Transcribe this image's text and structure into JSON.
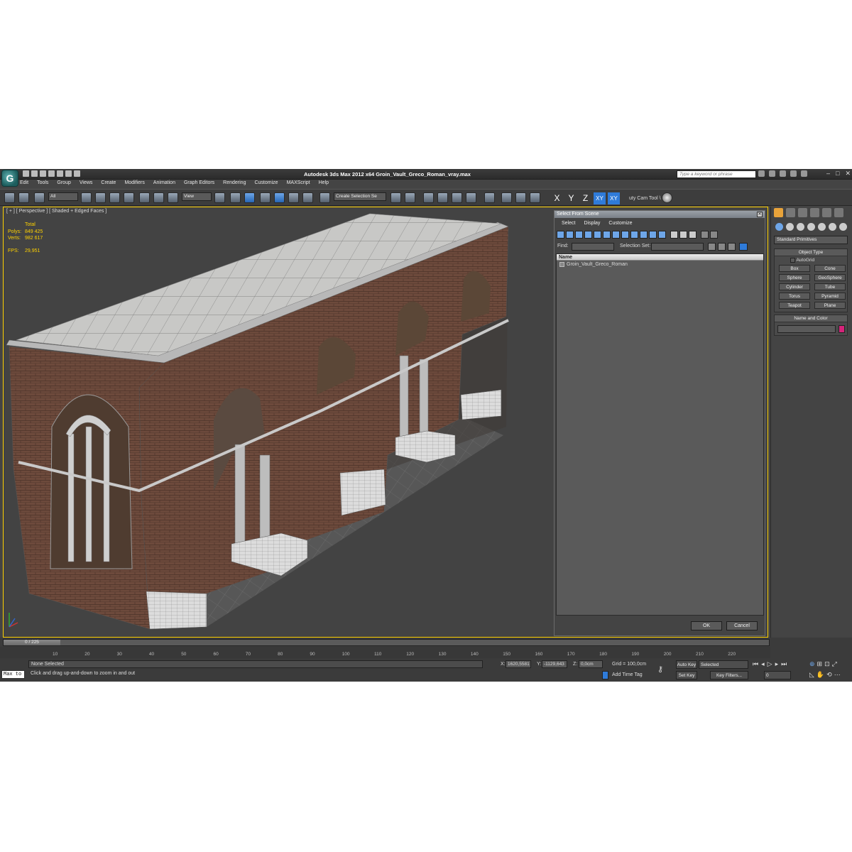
{
  "app": {
    "title": "Autodesk 3ds Max  2012 x64    Groin_Vault_Greco_Roman_vray.max",
    "search_placeholder": "Type a keyword or phrase",
    "logo_glyph": "G"
  },
  "menu": [
    "Edit",
    "Tools",
    "Group",
    "Views",
    "Create",
    "Modifiers",
    "Animation",
    "Graph Editors",
    "Rendering",
    "Customize",
    "MAXScript",
    "Help"
  ],
  "toolbar": {
    "filter": "All",
    "ref_coord": "View",
    "snaps_label": "3",
    "selection_set": "Create Selection Se",
    "axes": [
      "X",
      "Y",
      "Z",
      "XY",
      "XY"
    ],
    "cam_tool": "uty Cam Tool \\"
  },
  "viewport": {
    "label": "[ + ] [ Perspective ] [ Shaded + Edged Faces ]",
    "stats": {
      "total_label": "Total",
      "polys_label": "Polys:",
      "polys": "849 425",
      "verts_label": "Verts:",
      "verts": "982 617",
      "fps_label": "FPS:",
      "fps": "29,951"
    }
  },
  "dialog": {
    "title": "Select From Scene",
    "menu": [
      "Select",
      "Display",
      "Customize"
    ],
    "find_label": "Find:",
    "selection_set_label": "Selection Set:",
    "column_name": "Name",
    "items": [
      "Groin_Vault_Greco_Roman"
    ],
    "ok": "OK",
    "cancel": "Cancel"
  },
  "command_panel": {
    "category": "Standard Primitives",
    "object_type_title": "Object Type",
    "autogrid": "AutoGrid",
    "primitives": [
      "Box",
      "Cone",
      "Sphere",
      "GeoSphere",
      "Cylinder",
      "Tube",
      "Torus",
      "Pyramid",
      "Teapot",
      "Plane"
    ],
    "name_color_title": "Name and Color",
    "object_color": "#d6237a"
  },
  "timeline": {
    "position": "0 / 225",
    "ticks": [
      "10",
      "20",
      "30",
      "40",
      "50",
      "60",
      "70",
      "80",
      "90",
      "100",
      "110",
      "120",
      "130",
      "140",
      "150",
      "160",
      "170",
      "180",
      "190",
      "200",
      "210",
      "220"
    ]
  },
  "status": {
    "selection": "None Selected",
    "prompt": "Click and drag up-and-down to zoom in and out",
    "maxscript": "Max to",
    "x_label": "X:",
    "x": "1620,5581",
    "y_label": "Y:",
    "y": "-1129,643",
    "z_label": "Z:",
    "z": "0,0cm",
    "grid": "Grid = 100,0cm",
    "add_time_tag": "Add Time Tag",
    "auto_key": "Auto Key",
    "set_key": "Set Key",
    "key_mode": "Selected",
    "key_filters": "Key Filters...",
    "frame": "0"
  }
}
